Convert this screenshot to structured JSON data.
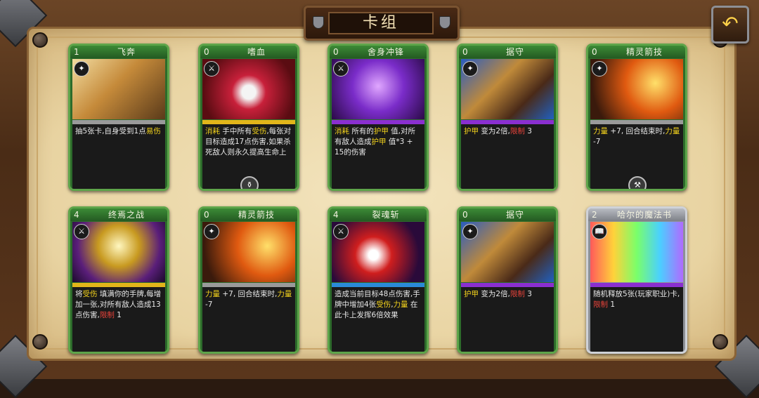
{
  "title": "卡组",
  "back_icon": "back-arrow-icon",
  "cards": [
    {
      "cost": "1",
      "name": "飞奔",
      "type_icon": "sparkle-icon",
      "bar_color": "#9a9a9a",
      "desc": [
        [
          "t",
          "抽5张卡,自身受到1点"
        ],
        [
          "y",
          "易伤"
        ]
      ]
    },
    {
      "cost": "0",
      "name": "嗜血",
      "type_icon": "sword-icon",
      "bar_color": "#e2b51a",
      "desc": [
        [
          "y",
          "消耗"
        ],
        [
          "t",
          " 手中所有"
        ],
        [
          "y",
          "受伤"
        ],
        [
          "t",
          ",每张对目标造成17点伤害,如果杀死敌人则永久提高生命上"
        ]
      ],
      "foot_icon": "potion-icon"
    },
    {
      "cost": "0",
      "name": "舍身冲锋",
      "type_icon": "sword-icon",
      "bar_color": "#8a2fd0",
      "desc": [
        [
          "y",
          "消耗"
        ],
        [
          "t",
          " 所有的"
        ],
        [
          "y",
          "护甲"
        ],
        [
          "t",
          " 值,对所有敌人造成"
        ],
        [
          "y",
          "护甲"
        ],
        [
          "t",
          " 值*3 + 15的伤害"
        ]
      ]
    },
    {
      "cost": "0",
      "name": "据守",
      "type_icon": "sparkle-icon",
      "bar_color": "#8a2fd0",
      "desc": [
        [
          "y",
          "护甲"
        ],
        [
          "t",
          " 变为2倍,"
        ],
        [
          "r",
          "限制"
        ],
        [
          "t",
          " 3"
        ]
      ]
    },
    {
      "cost": "0",
      "name": "精灵箭技",
      "type_icon": "sparkle-icon",
      "bar_color": "#9a9a9a",
      "desc": [
        [
          "y",
          "力量"
        ],
        [
          "t",
          " +7, 回合结束时,"
        ],
        [
          "y",
          "力量"
        ],
        [
          "t",
          " -7"
        ]
      ],
      "foot_icon": "crossed-tools-icon"
    },
    {
      "cost": "4",
      "name": "终焉之战",
      "type_icon": "sword-icon",
      "bar_color": "#e2b51a",
      "desc": [
        [
          "t",
          "将"
        ],
        [
          "y",
          "受伤"
        ],
        [
          "t",
          " 填满你的手牌,每增加一张,对所有敌人造成13点伤害,"
        ],
        [
          "r",
          "限制"
        ],
        [
          "t",
          " 1"
        ]
      ]
    },
    {
      "cost": "0",
      "name": "精灵箭技",
      "type_icon": "sparkle-icon",
      "bar_color": "#9a9a9a",
      "desc": [
        [
          "y",
          "力量"
        ],
        [
          "t",
          " +7, 回合结束时,"
        ],
        [
          "y",
          "力量"
        ],
        [
          "t",
          " -7"
        ]
      ]
    },
    {
      "cost": "4",
      "name": "裂魂斩",
      "type_icon": "sword-icon",
      "bar_color": "#2a8ad8",
      "desc": [
        [
          "t",
          "造成当前目标48点伤害,手牌中增加4张"
        ],
        [
          "y",
          "受伤"
        ],
        [
          "t",
          ","
        ],
        [
          "y",
          "力量"
        ],
        [
          "t",
          " 在此卡上发挥6倍效果"
        ]
      ]
    },
    {
      "cost": "0",
      "name": "据守",
      "type_icon": "sparkle-icon",
      "bar_color": "#8a2fd0",
      "desc": [
        [
          "y",
          "护甲"
        ],
        [
          "t",
          " 变为2倍,"
        ],
        [
          "r",
          "限制"
        ],
        [
          "t",
          " 3"
        ]
      ]
    },
    {
      "cost": "2",
      "name": "哈尔的魔法书",
      "type_icon": "book-icon",
      "bar_color": "#8a2fd0",
      "silver": true,
      "desc": [
        [
          "t",
          "随机释放5张(玩家职业)卡,"
        ],
        [
          "r",
          "限制"
        ],
        [
          "t",
          " 1"
        ]
      ]
    }
  ]
}
